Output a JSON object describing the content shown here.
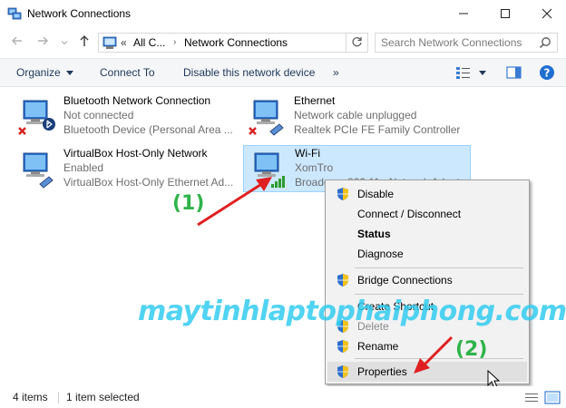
{
  "window": {
    "title": "Network Connections",
    "controls": {
      "minimize": "—",
      "maximize": "☐",
      "close": "✕"
    }
  },
  "address": {
    "prefix": "«",
    "crumbs": [
      "All C...",
      "Network Connections"
    ],
    "search_placeholder": "Search Network Connections"
  },
  "toolbar": {
    "organize": "Organize",
    "connect_to": "Connect To",
    "disable": "Disable this network device",
    "more": "»"
  },
  "connections": [
    {
      "name": "Bluetooth Network Connection",
      "status": "Not connected",
      "device": "Bluetooth Device (Personal Area ...",
      "badge": "bluetooth-error"
    },
    {
      "name": "Ethernet",
      "status": "Network cable unplugged",
      "device": "Realtek PCIe FE Family Controller",
      "badge": "cable-error"
    },
    {
      "name": "VirtualBox Host-Only Network",
      "status": "Enabled",
      "device": "VirtualBox Host-Only Ethernet Ad...",
      "badge": "cable"
    },
    {
      "name": "Wi-Fi",
      "status": "XomTro",
      "device": "Broadcom 802.11n Network Adapter",
      "badge": "signal"
    }
  ],
  "context_menu": {
    "items": [
      {
        "label": "Disable",
        "shield": true,
        "bold": false
      },
      {
        "label": "Connect / Disconnect",
        "shield": false,
        "bold": false
      },
      {
        "label": "Status",
        "shield": false,
        "bold": true
      },
      {
        "label": "Diagnose",
        "shield": false,
        "bold": false
      },
      {
        "label": "Bridge Connections",
        "shield": true,
        "bold": false
      },
      {
        "label": "Create Shortcut",
        "shield": false,
        "bold": false
      },
      {
        "label": "Delete",
        "shield": true,
        "bold": false
      },
      {
        "label": "Rename",
        "shield": true,
        "bold": false
      },
      {
        "label": "Properties",
        "shield": true,
        "bold": false
      }
    ]
  },
  "statusbar": {
    "count": "4 items",
    "selected": "1 item selected"
  },
  "annotations": {
    "step1": "(1)",
    "step2": "(2)",
    "watermark": "maytinhlaptophaiphong.com"
  },
  "colors": {
    "accent": "#cce8ff",
    "selection_border": "#99d1ff",
    "annotation_green": "#2fb34a",
    "arrow_red": "#e02020",
    "watermark": "#33ccf0"
  }
}
